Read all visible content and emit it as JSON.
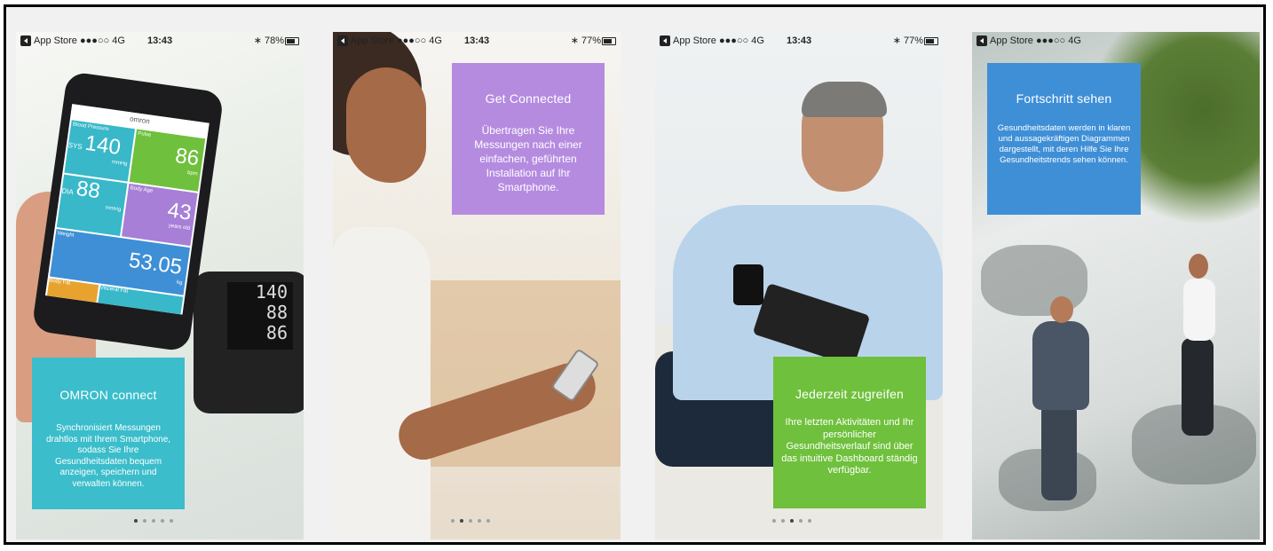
{
  "status_bars": [
    {
      "carrier": "App Store ●●●○○  4G",
      "time": "13:43",
      "right": "∗ 78%"
    },
    {
      "carrier": "App Store ●●●○○  4G",
      "time": "13:43",
      "right": "∗ 77%"
    },
    {
      "carrier": "App Store ●●●○○  4G",
      "time": "13:43",
      "right": "∗ 77%"
    },
    {
      "carrier": "App Store ●●●○○  4G",
      "time": "13:43",
      "right": ""
    }
  ],
  "phone_app": {
    "brand": "omron",
    "tiles": [
      {
        "label": "Blood Pressure",
        "value": "140",
        "unit": "mmHg",
        "sub": "SYS"
      },
      {
        "label": "Pulse",
        "value": "86",
        "unit": "bpm"
      },
      {
        "label": "DIA",
        "value": "88",
        "unit": "mmHg"
      },
      {
        "label": "Body Age",
        "value": "43",
        "unit": "years old"
      },
      {
        "label": "Weight",
        "value": "53.05",
        "unit": "kg"
      },
      {
        "label": "Body Fat",
        "value": "",
        "unit": ""
      },
      {
        "label": "Visceral Fat",
        "value": "",
        "unit": ""
      }
    ]
  },
  "device_display": [
    "140",
    "88",
    "86"
  ],
  "cards": [
    {
      "title": "OMRON connect",
      "text": "Synchronisiert Messungen drahtlos mit Ihrem Smartphone, sodass Sie Ihre Gesundheitsdaten bequem anzeigen, speichern und verwalten können.",
      "color": "#3bbdcb"
    },
    {
      "title": "Get Connected",
      "text": "Übertragen Sie Ihre Messungen nach einer einfachen, geführten Installation auf Ihr Smartphone.",
      "color": "#b58be0"
    },
    {
      "title": "Jederzeit zugreifen",
      "text": "Ihre letzten Aktivitäten und Ihr persönlicher Gesundheitsverlauf sind über das intuitive Dashboard ständig verfügbar.",
      "color": "#6fc03c"
    },
    {
      "title": "Fortschritt sehen",
      "text": "Gesundheitsdaten werden in klaren und aussagekräftigen Diagrammen dargestellt, mit deren Hilfe Sie Ihre Gesundheitstrends sehen können.",
      "color": "#3f8fd6"
    }
  ],
  "pagination": [
    {
      "active": 0,
      "count": 5
    },
    {
      "active": 1,
      "count": 5
    },
    {
      "active": 2,
      "count": 5
    }
  ]
}
